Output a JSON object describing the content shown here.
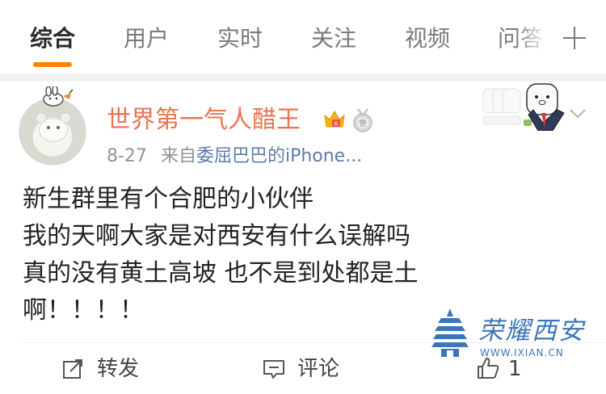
{
  "tabs": {
    "items": [
      {
        "label": "综合"
      },
      {
        "label": "用户"
      },
      {
        "label": "实时"
      },
      {
        "label": "关注"
      },
      {
        "label": "视频"
      },
      {
        "label": "问答"
      }
    ],
    "active_index": 0,
    "accent_color": "#ff8200"
  },
  "post": {
    "username": "世界第一气人醋王",
    "username_color": "#eb7350",
    "date": "8-27",
    "source_prefix": "来自",
    "source": "委屈巴巴的iPhone...",
    "source_color": "#5f7ba8",
    "content_lines": [
      "新生群里有个合肥的小伙伴",
      "我的天啊大家是对西安有什么误解吗",
      "真的没有黄土高坡 也不是到处都是土",
      "啊！！！！"
    ],
    "badges": [
      "crown-icon",
      "medal-icon"
    ]
  },
  "actions": {
    "repost_label": "转发",
    "comment_label": "评论",
    "like_count": "1"
  },
  "watermark": {
    "title": "荣耀西安",
    "url": "WWW.IXIAN.CN",
    "color": "#3c76b9"
  }
}
